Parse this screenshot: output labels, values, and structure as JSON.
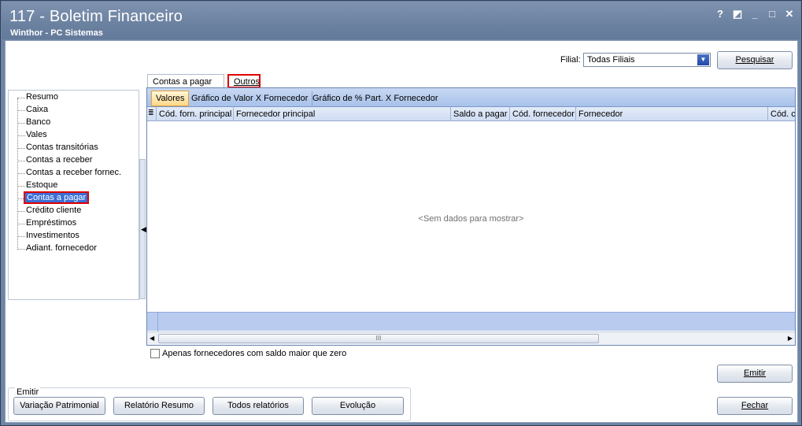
{
  "window": {
    "title": "117 - Boletim Financeiro",
    "subtitle": "Winthor - PC Sistemas",
    "controls": [
      "?",
      "◩",
      "_",
      "□",
      "✕"
    ]
  },
  "filter": {
    "filial_label": "Filial:",
    "filial_value": "Todas Filiais",
    "search_button": "Pesquisar"
  },
  "tree": {
    "items": [
      {
        "label": "Resumo",
        "selected": false
      },
      {
        "label": "Caixa",
        "selected": false
      },
      {
        "label": "Banco",
        "selected": false
      },
      {
        "label": "Vales",
        "selected": false
      },
      {
        "label": "Contas transitórias",
        "selected": false
      },
      {
        "label": "Contas a receber",
        "selected": false
      },
      {
        "label": "Contas a receber fornec.",
        "selected": false
      },
      {
        "label": "Estoque",
        "selected": false
      },
      {
        "label": "Contas a pagar",
        "selected": true
      },
      {
        "label": "Crédito cliente",
        "selected": false
      },
      {
        "label": "Empréstimos",
        "selected": false
      },
      {
        "label": "Investimentos",
        "selected": false
      },
      {
        "label": "Adiant. fornecedor",
        "selected": false
      }
    ]
  },
  "tabs": {
    "contas_a_pagar": "Contas a pagar",
    "outros": "Outros"
  },
  "subtabs": {
    "valores": "Valores",
    "grafico_valor": "Gráfico de Valor X Fornecedor",
    "grafico_percent": "Gráfico de % Part. X Fornecedor"
  },
  "grid": {
    "columns": [
      "Cód. forn. principal",
      "Fornecedor principal",
      "Saldo a pagar",
      "Cód. fornecedor",
      "Fornecedor",
      "Cód. c"
    ],
    "empty_text": "<Sem dados para mostrar>",
    "scroll_grip": "III"
  },
  "checkbox": {
    "label": "Apenas fornecedores com saldo maior que zero",
    "checked": false
  },
  "emitir_group": {
    "label": "Emitir",
    "buttons": {
      "variacao": "Variação Patrimonial",
      "relatorio": "Relatório Resumo",
      "todos": "Todos relatórios",
      "evolucao": "Evolução"
    }
  },
  "actions": {
    "emitir": "Emitir",
    "fechar": "Fechar"
  },
  "colors": {
    "titlebar": "#6b81a0",
    "selection": "#3b6fd6",
    "highlight_box": "#e00000",
    "subtab_bar": "#a8c2ea"
  }
}
